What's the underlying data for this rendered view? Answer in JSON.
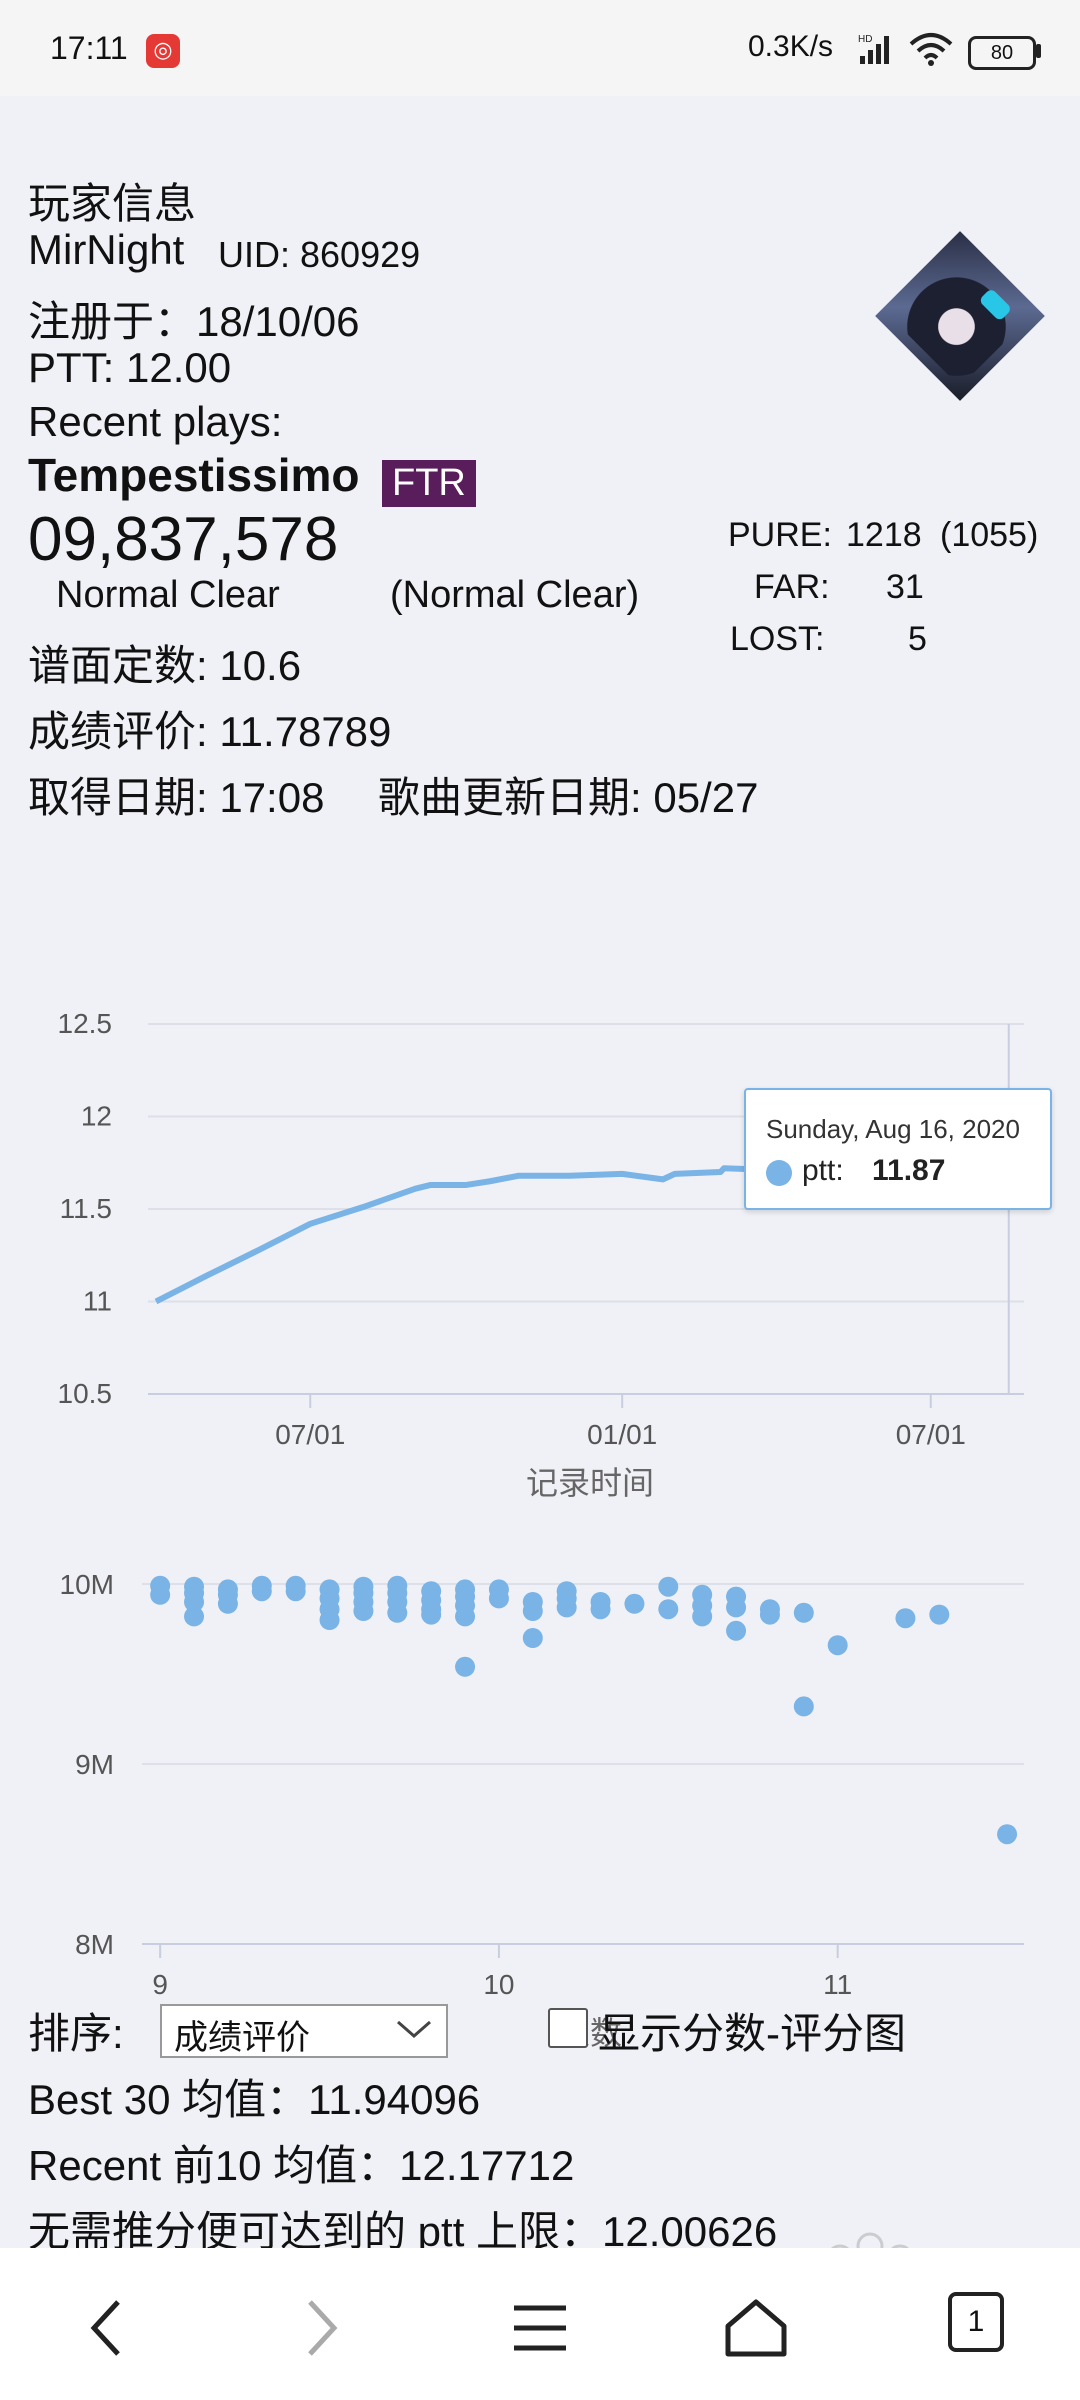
{
  "status_bar": {
    "time": "17:11",
    "app_badge": "◎",
    "network_speed": "0.3K/s",
    "signal": "HD",
    "battery": "80"
  },
  "page_top_cutoff": "…",
  "player": {
    "section_title": "玩家信息",
    "name": "MirNight",
    "uid": "UID: 860929",
    "registered": "注册于：18/10/06",
    "ptt": "PTT: 12.00",
    "recent_label": "Recent plays:"
  },
  "recent_play": {
    "song": "Tempestissimo",
    "difficulty": "FTR",
    "score": "09,837,578",
    "clear_type": "Normal Clear",
    "clear_type_best": "(Normal Clear)",
    "pure_label": "PURE:",
    "pure_value": "1218",
    "pure_extra": "(1055)",
    "far_label": "FAR:",
    "far_value": "31",
    "lost_label": "LOST:",
    "lost_value": "5",
    "chart_constant": "谱面定数: 10.6",
    "rating": "成绩评价: 11.78789",
    "obtained": "取得日期: 17:08",
    "song_updated": "歌曲更新日期: 05/27"
  },
  "chart_data": [
    {
      "type": "line",
      "title": "",
      "xlabel": "记录时间",
      "ylabel": "",
      "x_tick_labels": [
        "07/01",
        "01/01",
        "07/01"
      ],
      "y_tick_labels": [
        "12.5",
        "12",
        "11.5",
        "11",
        "10.5"
      ],
      "ylim": [
        10.5,
        12.5
      ],
      "xlim": [
        "2019-04-01",
        "2020-08-25"
      ],
      "grid": true,
      "series": [
        {
          "name": "ptt",
          "color": "#7ab3e6",
          "x": [
            "2019-04-01",
            "2019-05-01",
            "2019-06-01",
            "2019-07-01",
            "2019-08-01",
            "2019-09-01",
            "2019-09-10",
            "2019-09-15",
            "2019-10-01",
            "2019-10-15",
            "2019-11-01",
            "2019-12-01",
            "2020-01-01",
            "2020-01-25",
            "2020-02-01",
            "2020-02-28",
            "2020-03-01",
            "2020-04-01",
            "2020-05-01",
            "2020-06-01",
            "2020-07-01",
            "2020-08-16"
          ],
          "values": [
            11.0,
            11.14,
            11.28,
            11.42,
            11.51,
            11.61,
            11.63,
            11.63,
            11.63,
            11.65,
            11.68,
            11.68,
            11.69,
            11.66,
            11.69,
            11.7,
            11.72,
            11.71,
            11.68,
            11.66,
            11.74,
            11.87
          ]
        }
      ],
      "tooltip": {
        "date": "Sunday, Aug 16, 2020",
        "series": "ptt:",
        "value": "11.87"
      }
    },
    {
      "type": "scatter",
      "title": "",
      "xlabel": "定数",
      "ylabel": "",
      "x_tick_labels": [
        "9",
        "10",
        "11"
      ],
      "y_tick_labels": [
        "10M",
        "9M",
        "8M"
      ],
      "xlim": [
        8.97,
        11.55
      ],
      "ylim": [
        8000000,
        10000000
      ],
      "grid": true,
      "series": [
        {
          "name": "score",
          "color": "#7ab3e6",
          "points": [
            [
              9.0,
              9990000
            ],
            [
              9.0,
              9940000
            ],
            [
              9.1,
              9985000
            ],
            [
              9.1,
              9950000
            ],
            [
              9.1,
              9900000
            ],
            [
              9.1,
              9820000
            ],
            [
              9.2,
              9970000
            ],
            [
              9.2,
              9940000
            ],
            [
              9.2,
              9890000
            ],
            [
              9.3,
              9990000
            ],
            [
              9.3,
              9960000
            ],
            [
              9.4,
              9990000
            ],
            [
              9.4,
              9960000
            ],
            [
              9.5,
              9970000
            ],
            [
              9.5,
              9920000
            ],
            [
              9.5,
              9860000
            ],
            [
              9.5,
              9800000
            ],
            [
              9.6,
              9985000
            ],
            [
              9.6,
              9950000
            ],
            [
              9.6,
              9900000
            ],
            [
              9.6,
              9850000
            ],
            [
              9.7,
              9990000
            ],
            [
              9.7,
              9950000
            ],
            [
              9.7,
              9900000
            ],
            [
              9.7,
              9840000
            ],
            [
              9.8,
              9960000
            ],
            [
              9.8,
              9910000
            ],
            [
              9.8,
              9860000
            ],
            [
              9.8,
              9830000
            ],
            [
              9.9,
              9970000
            ],
            [
              9.9,
              9930000
            ],
            [
              9.9,
              9880000
            ],
            [
              9.9,
              9820000
            ],
            [
              9.9,
              9540000
            ],
            [
              10.0,
              9970000
            ],
            [
              10.0,
              9920000
            ],
            [
              10.1,
              9900000
            ],
            [
              10.1,
              9850000
            ],
            [
              10.1,
              9700000
            ],
            [
              10.2,
              9960000
            ],
            [
              10.2,
              9920000
            ],
            [
              10.2,
              9870000
            ],
            [
              10.3,
              9900000
            ],
            [
              10.3,
              9860000
            ],
            [
              10.4,
              9890000
            ],
            [
              10.5,
              9985000
            ],
            [
              10.5,
              9860000
            ],
            [
              10.6,
              9940000
            ],
            [
              10.6,
              9880000
            ],
            [
              10.6,
              9820000
            ],
            [
              10.7,
              9930000
            ],
            [
              10.7,
              9870000
            ],
            [
              10.7,
              9740000
            ],
            [
              10.8,
              9860000
            ],
            [
              10.8,
              9830000
            ],
            [
              10.9,
              9840000
            ],
            [
              10.9,
              9320000
            ],
            [
              11.0,
              9660000
            ],
            [
              11.2,
              9810000
            ],
            [
              11.3,
              9830000
            ],
            [
              11.5,
              8610000
            ]
          ]
        }
      ]
    }
  ],
  "controls": {
    "sort_label": "排序:",
    "sort_value": "成绩评价",
    "show_chart_label": "显示分数-评分图"
  },
  "stats": {
    "best30": "Best 30 均值：11.94096",
    "recent10": "Recent 前10 均值：12.17712",
    "max_ptt": "无需推分便可达到的 ptt 上限：12.00626"
  },
  "navbar": {
    "tabs_count": "1"
  }
}
